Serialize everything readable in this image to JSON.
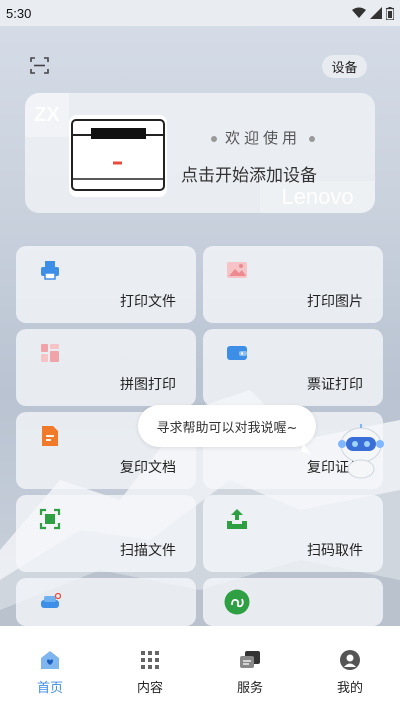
{
  "status_bar": {
    "time": "5:30"
  },
  "header": {
    "device_label": "设备"
  },
  "banner": {
    "welcome": "欢迎使用",
    "add_device": "点击开始添加设备",
    "watermark_left": "ZX",
    "watermark_right": "Lenovo"
  },
  "features": [
    {
      "label": "打印文件",
      "icon": "printer-icon",
      "color": "#3d8ee6"
    },
    {
      "label": "打印图片",
      "icon": "image-icon",
      "color": "#f0a3a8"
    },
    {
      "label": "拼图打印",
      "icon": "collage-icon",
      "color": "#f0a3a8"
    },
    {
      "label": "票证打印",
      "icon": "wallet-icon",
      "color": "#3d8ee6"
    },
    {
      "label": "复印文档",
      "icon": "document-icon",
      "color": "#f07a2a"
    },
    {
      "label": "复印证件",
      "icon": "id-card-icon",
      "color": "#3d8ee6"
    },
    {
      "label": "扫描文件",
      "icon": "scan-icon",
      "color": "#2ea043"
    },
    {
      "label": "扫码取件",
      "icon": "upload-tray-icon",
      "color": "#2ea043"
    },
    {
      "label": "",
      "icon": "sofa-printer-icon",
      "color": "#3d8ee6"
    },
    {
      "label": "",
      "icon": "mini-program-icon",
      "color": "#2ea043"
    }
  ],
  "assistant": {
    "bubble": "寻求帮助可以对我说喔~"
  },
  "tabbar": {
    "tabs": [
      {
        "label": "首页",
        "icon": "home-icon",
        "active": true
      },
      {
        "label": "内容",
        "icon": "grid-dots-icon",
        "active": false
      },
      {
        "label": "服务",
        "icon": "chat-icon",
        "active": false
      },
      {
        "label": "我的",
        "icon": "profile-icon",
        "active": false
      }
    ]
  },
  "colors": {
    "accent": "#3d8ee6",
    "card_bg": "#f5f7fa"
  }
}
